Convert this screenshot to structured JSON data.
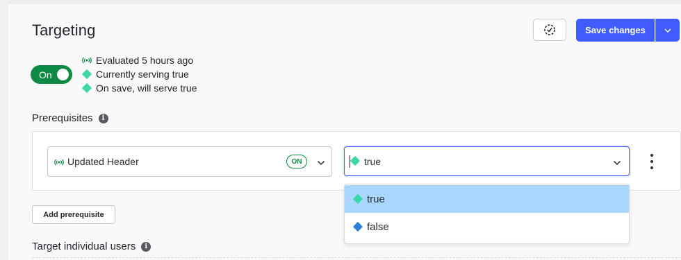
{
  "header": {
    "title": "Targeting",
    "save_label": "Save changes"
  },
  "toggle": {
    "label": "On",
    "state": "on"
  },
  "status": {
    "evaluated": "Evaluated 5 hours ago",
    "serving": "Currently serving true",
    "on_save": "On save, will serve true"
  },
  "prerequisites": {
    "heading": "Prerequisites",
    "info_icon": "i",
    "flag_name": "Updated Header",
    "flag_badge": "ON",
    "variation_value": "true",
    "add_label": "Add prerequisite",
    "options": [
      {
        "label": "true",
        "color": "#3dd6a7",
        "selected": true
      },
      {
        "label": "false",
        "color": "#2f7fd8",
        "selected": false
      }
    ]
  },
  "target_users": {
    "heading": "Target individual users",
    "info_icon": "i"
  },
  "colors": {
    "accent": "#405bff",
    "on_green": "#0d8a43",
    "true_variation": "#3dd6a7",
    "false_variation": "#2f7fd8",
    "selected_option_bg": "#a9d7ff"
  },
  "icons": {
    "history": "history-icon",
    "caret": "chevron-down-icon",
    "live": "live-signal-icon",
    "more": "kebab-menu-icon"
  }
}
